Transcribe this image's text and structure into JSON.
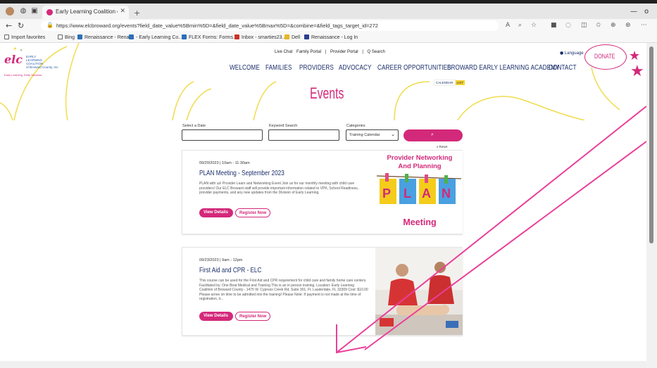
{
  "browser": {
    "tab_title": "Early Learning Coalition of Browar",
    "url": "https://www.elcbroward.org/events?field_date_value%5Bmin%5D=&field_date_value%5Bmax%5D=&combine=&field_tags_target_id=272",
    "favorites": [
      "Import favorites",
      "Bing",
      "Renaissance - Renai...",
      "- Early Learning Co...",
      "FLEX Forms: Forms...",
      "Inbox - smarties23...",
      "Dell",
      "Renaissance - Log In"
    ]
  },
  "site": {
    "logo_mark": "elc",
    "logo_text": "EARLY\nLEARNING\nCOALITION\nof Broward County, Inc.",
    "logo_tagline": "Early Learning, Early Success",
    "top_links": [
      "Live Chat",
      "Family Portal",
      "|",
      "Provider Portal",
      "|",
      "Q Search"
    ],
    "language": "Language",
    "donate": "DONATE",
    "nav": [
      "WELCOME",
      "FAMILIES",
      "PROVIDERS",
      "ADVOCACY",
      "CAREER OPPORTUNITIES",
      "BROWARD EARLY LEARNING ACADEMY",
      "CONTACT"
    ]
  },
  "events": {
    "title": "Events",
    "view_calendar": "CALENDAR",
    "view_list": "LIST",
    "filters": {
      "date_label": "Select a Date",
      "keyword_label": "Keyword Search",
      "categories_label": "Categories",
      "category_value": "Training Calendar",
      "clear": "x Reset"
    },
    "items": [
      {
        "date": "09/20/2023 | 10am - 11:30am",
        "title": "PLAN Meeting - September 2023",
        "description": "PLAN with us! Provider Learn and Networking Event Join us for our monthly meeting with child care providers! Our ELC Broward staff will provide important information related to VPK, School Readiness, provider payments, and any new updates from the Division of Early Learning.",
        "view": "View Details",
        "register": "Register Now",
        "image_heading_1": "Provider Networking",
        "image_heading_2": "And Planning",
        "image_letters": [
          "P",
          "L",
          "A",
          "N"
        ],
        "image_footer": "Meeting"
      },
      {
        "date": "09/23/2023 | 9am - 12pm",
        "title": "First Aid and CPR - ELC",
        "description": "This course can be used for the First Aid and CPR requirement for child care and family home care centers.  Facilitated by: One Beat Medical and Training This is an in person training. Location: Early Learning Coalition of Broward County - 1475 W. Cypress Creek Rd, Suite 301, Ft. Lauderdale, FL 33309 Cost: $10.00 Please arrive on time to be admitted into the training!  Please Note: If payment is not made at the time of registration, it...",
        "view": "View Details",
        "register": "Register Now"
      }
    ]
  }
}
